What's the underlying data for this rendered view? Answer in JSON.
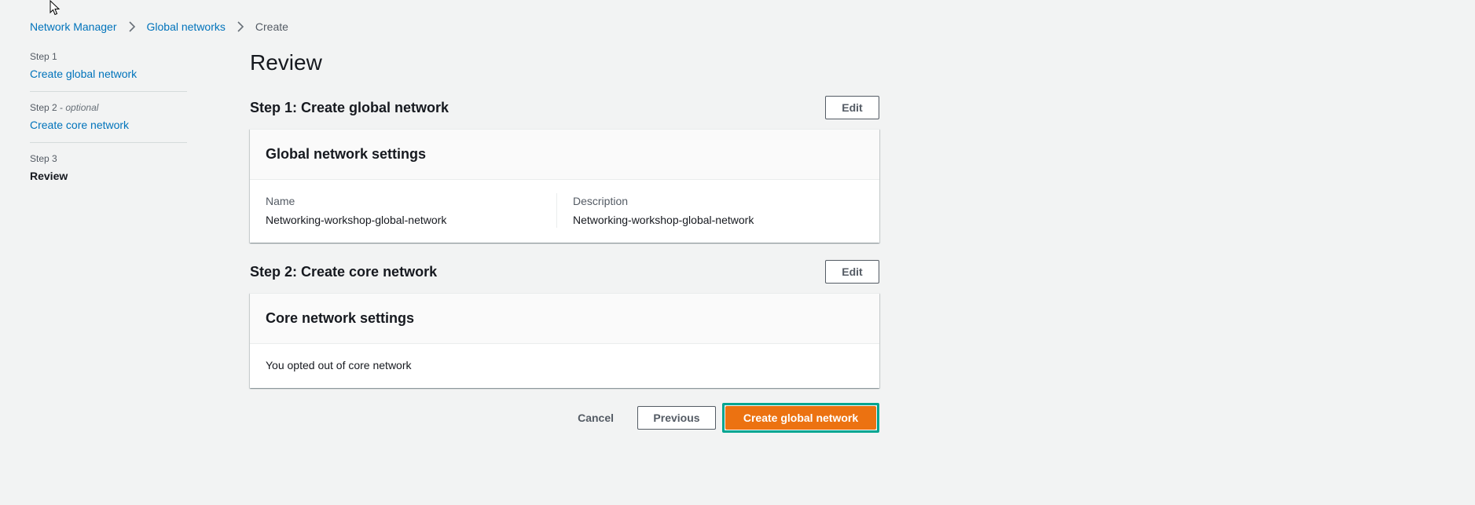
{
  "breadcrumb": {
    "items": [
      "Network Manager",
      "Global networks"
    ],
    "current": "Create"
  },
  "steps": [
    {
      "number": "Step 1",
      "optional": "",
      "label": "Create global network"
    },
    {
      "number": "Step 2",
      "optional": "optional",
      "label": "Create core network"
    },
    {
      "number": "Step 3",
      "optional": "",
      "label": "Review"
    }
  ],
  "main": {
    "title": "Review",
    "section1": {
      "title": "Step 1: Create global network",
      "edit_label": "Edit",
      "container_title": "Global network settings",
      "fields": [
        {
          "label": "Name",
          "value": "Networking-workshop-global-network"
        },
        {
          "label": "Description",
          "value": "Networking-workshop-global-network"
        }
      ]
    },
    "section2": {
      "title": "Step 2: Create core network",
      "edit_label": "Edit",
      "container_title": "Core network settings",
      "body": "You opted out of core network"
    }
  },
  "actions": {
    "cancel": "Cancel",
    "previous": "Previous",
    "primary": "Create global network"
  },
  "colors": {
    "link": "#0073bb",
    "primary": "#ec7211",
    "focus_ring": "#00a591",
    "background": "#f2f3f3"
  }
}
